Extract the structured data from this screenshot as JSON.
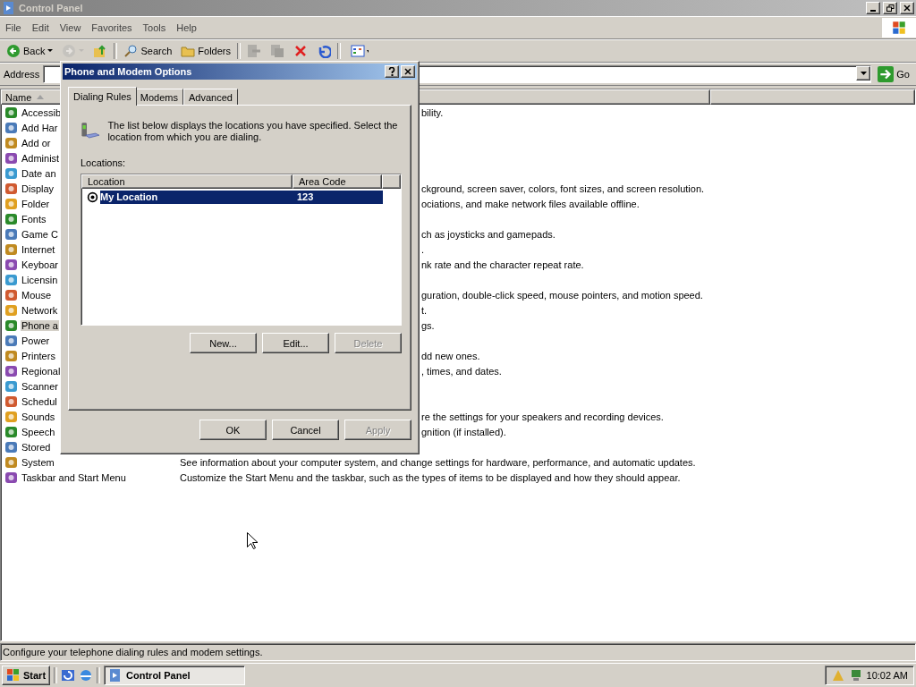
{
  "window": {
    "title": "Control Panel"
  },
  "menu": [
    "File",
    "Edit",
    "View",
    "Favorites",
    "Tools",
    "Help"
  ],
  "toolbar": [
    {
      "kind": "back",
      "label": "Back",
      "disabled": false
    },
    {
      "kind": "forward",
      "disabled": true
    },
    {
      "kind": "up",
      "disabled": false
    },
    {
      "kind": "search",
      "label": "Search",
      "disabled": false
    },
    {
      "kind": "folders",
      "label": "Folders",
      "disabled": false
    },
    {
      "kind": "move",
      "disabled": true
    },
    {
      "kind": "copy",
      "disabled": true
    },
    {
      "kind": "delete",
      "disabled": false
    },
    {
      "kind": "undo",
      "disabled": false
    },
    {
      "kind": "views",
      "disabled": false
    }
  ],
  "address": {
    "label": "Address",
    "go": "Go"
  },
  "columns": [
    "Name"
  ],
  "items": [
    {
      "name": "Accessib",
      "selected": false,
      "kind": "clipped",
      "description": "bility."
    },
    {
      "name": "Add Har",
      "selected": false
    },
    {
      "name": "Add or",
      "selected": false
    },
    {
      "name": "Administ",
      "selected": false
    },
    {
      "name": "Date an",
      "selected": false
    },
    {
      "name": "Display",
      "selected": false,
      "kind": "clipped",
      "description": "ckground, screen saver, colors, font sizes, and screen resolution."
    },
    {
      "name": "Folder",
      "selected": false,
      "kind": "clipped",
      "description": "ociations, and make network files available offline."
    },
    {
      "name": "Fonts",
      "selected": false
    },
    {
      "name": "Game C",
      "selected": false,
      "kind": "clipped",
      "description": "ch as joysticks and gamepads."
    },
    {
      "name": "Internet",
      "selected": false,
      "kind": "clipped",
      "description": "."
    },
    {
      "name": "Keyboar",
      "selected": false,
      "kind": "clipped",
      "description": "nk rate and the character repeat rate."
    },
    {
      "name": "Licensin",
      "selected": false
    },
    {
      "name": "Mouse",
      "selected": false,
      "kind": "clipped",
      "description": "guration, double-click speed, mouse pointers, and motion speed."
    },
    {
      "name": "Network",
      "selected": false,
      "kind": "clipped",
      "description": "t."
    },
    {
      "name": "Phone a",
      "selected": true,
      "kind": "clipped",
      "description": "gs."
    },
    {
      "name": "Power",
      "selected": false
    },
    {
      "name": "Printers",
      "selected": false,
      "kind": "clipped",
      "description": "dd new ones."
    },
    {
      "name": "Regional",
      "selected": false,
      "kind": "clipped",
      "description": ", times, and dates."
    },
    {
      "name": "Scanner",
      "selected": false
    },
    {
      "name": "Schedul",
      "selected": false
    },
    {
      "name": "Sounds",
      "selected": false,
      "kind": "clipped",
      "description": "re the settings for your speakers and recording devices."
    },
    {
      "name": "Speech",
      "selected": false,
      "kind": "clipped",
      "description": "gnition (if installed)."
    },
    {
      "name": "Stored",
      "selected": false
    },
    {
      "name": "System",
      "selected": false,
      "kind": "full",
      "description": "See information about your computer system, and change settings for hardware, performance, and automatic updates."
    },
    {
      "name": "Taskbar and Start Menu",
      "selected": false,
      "kind": "full",
      "description": "Customize the Start Menu and the taskbar, such as the types of items to be displayed and how they should appear."
    }
  ],
  "status_bar": "Configure your telephone dialing rules and modem settings.",
  "dialog": {
    "title": "Phone and Modem Options",
    "tabs": [
      {
        "label": "Dialing Rules",
        "selected": true
      },
      {
        "label": "Modems",
        "selected": false
      },
      {
        "label": "Advanced",
        "selected": false
      }
    ],
    "intro": "The list below displays the locations you have specified. Select the location from which you are dialing.",
    "list_label": "Locations:",
    "columns": [
      "Location",
      "Area Code"
    ],
    "rows": [
      {
        "location": "My Location",
        "area_code": "123",
        "selected": true
      }
    ],
    "list_buttons": [
      {
        "label": "New...",
        "disabled": false
      },
      {
        "label": "Edit...",
        "disabled": false
      },
      {
        "label": "Delete",
        "disabled": true
      }
    ],
    "buttons": [
      {
        "label": "OK",
        "disabled": false
      },
      {
        "label": "Cancel",
        "disabled": false
      },
      {
        "label": "Apply",
        "disabled": true
      }
    ]
  },
  "taskbar": {
    "start": "Start",
    "tasks": [
      {
        "label": "Control Panel",
        "selected": true
      }
    ],
    "clock": "10:02 AM"
  }
}
